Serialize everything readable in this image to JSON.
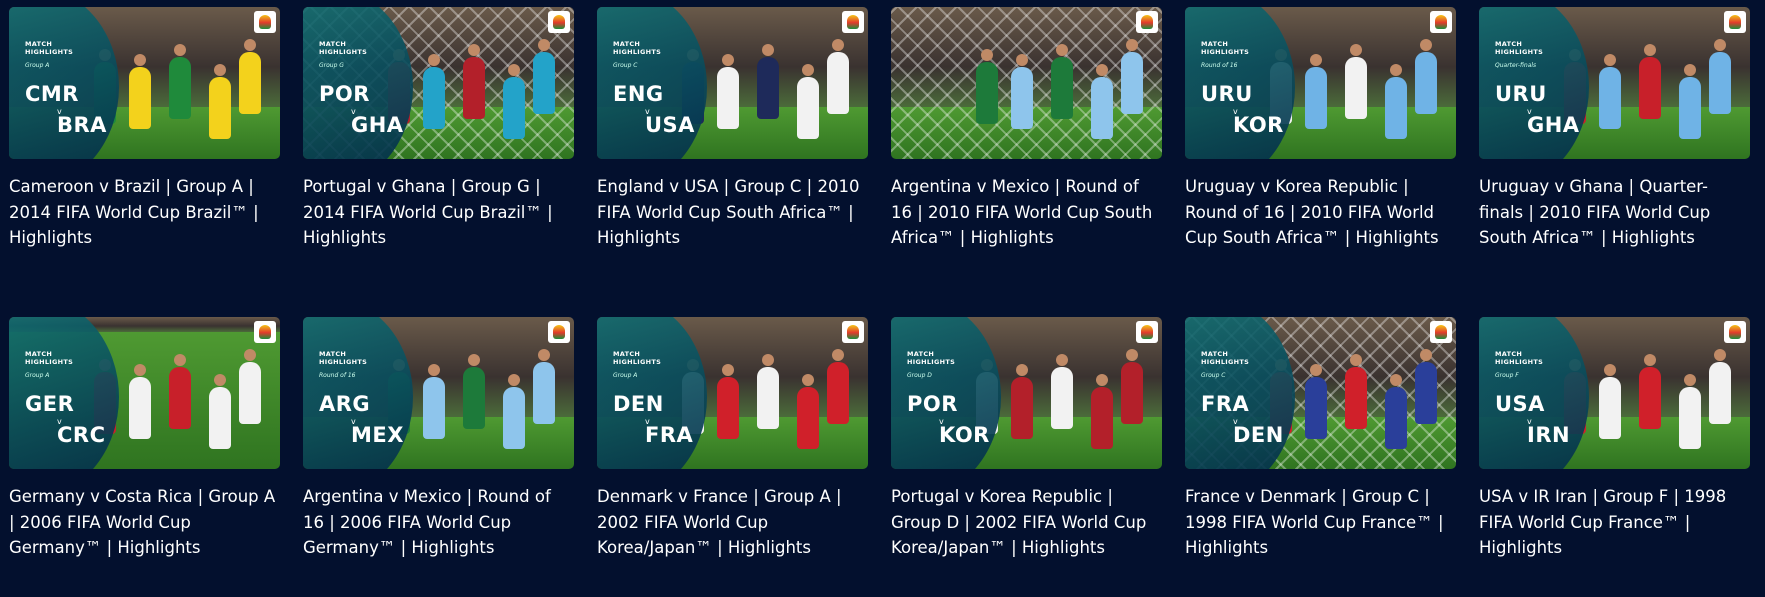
{
  "cards": [
    {
      "home": "CMR",
      "away": "BRA",
      "stage": "Group A",
      "match_highlights": "MATCH HIGHLIGHTS",
      "overlay": true,
      "title": "Cameroon v Brazil | Group A | 2014 FIFA World Cup Brazil™ | Highlights",
      "kit_a": "#f3d21c",
      "kit_b": "#1f8a3b",
      "scene": "stands"
    },
    {
      "home": "POR",
      "away": "GHA",
      "stage": "Group G",
      "match_highlights": "MATCH HIGHLIGHTS",
      "overlay": true,
      "title": "Portugal v Ghana | Group G | 2014 FIFA World Cup Brazil™ | Highlights",
      "kit_a": "#23a3c9",
      "kit_b": "#b3202a",
      "scene": "net"
    },
    {
      "home": "ENG",
      "away": "USA",
      "stage": "Group C",
      "match_highlights": "MATCH HIGHLIGHTS",
      "overlay": true,
      "title": "England v USA | Group C | 2010 FIFA World Cup South Africa™ | Highlights",
      "kit_a": "#f2f2f2",
      "kit_b": "#1e2a5a",
      "scene": "stands"
    },
    {
      "home": "",
      "away": "",
      "stage": "",
      "match_highlights": "",
      "overlay": false,
      "title": "Argentina v Mexico | Round of 16 | 2010 FIFA World Cup South Africa™ | Highlights",
      "kit_a": "#8ec5ec",
      "kit_b": "#1d7a3a",
      "scene": "net"
    },
    {
      "home": "URU",
      "away": "KOR",
      "stage": "Round of 16",
      "match_highlights": "MATCH HIGHLIGHTS",
      "overlay": true,
      "title": "Uruguay v Korea Republic | Round of 16 | 2010 FIFA World Cup South Africa™ | Highlights",
      "kit_a": "#6fb3e6",
      "kit_b": "#f2f2f2",
      "scene": "stands"
    },
    {
      "home": "URU",
      "away": "GHA",
      "stage": "Quarter-finals",
      "match_highlights": "MATCH HIGHLIGHTS",
      "overlay": true,
      "title": "Uruguay v Ghana | Quarter-finals | 2010 FIFA World Cup South Africa™ | Highlights",
      "kit_a": "#6fb3e6",
      "kit_b": "#c8202a",
      "scene": "stands"
    },
    {
      "home": "GER",
      "away": "CRC",
      "stage": "Group A",
      "match_highlights": "MATCH HIGHLIGHTS",
      "overlay": true,
      "title": "Germany v Costa Rica | Group A | 2006 FIFA World Cup Germany™ | Highlights",
      "kit_a": "#f2f2f2",
      "kit_b": "#c8202a",
      "scene": "pitch"
    },
    {
      "home": "ARG",
      "away": "MEX",
      "stage": "Round of 16",
      "match_highlights": "MATCH HIGHLIGHTS",
      "overlay": true,
      "title": "Argentina v Mexico | Round of 16 | 2006 FIFA World Cup Germany™ | Highlights",
      "kit_a": "#8ec5ec",
      "kit_b": "#1d7a3a",
      "scene": "stands"
    },
    {
      "home": "DEN",
      "away": "FRA",
      "stage": "Group A",
      "match_highlights": "MATCH HIGHLIGHTS",
      "overlay": true,
      "title": "Denmark v France | Group A | 2002 FIFA World Cup Korea/Japan™ | Highlights",
      "kit_a": "#d0202a",
      "kit_b": "#f2f2f2",
      "scene": "stands"
    },
    {
      "home": "POR",
      "away": "KOR",
      "stage": "Group D",
      "match_highlights": "MATCH HIGHLIGHTS",
      "overlay": true,
      "title": "Portugal v Korea Republic | Group D | 2002 FIFA World Cup Korea/Japan™ | Highlights",
      "kit_a": "#b3202a",
      "kit_b": "#f2f2f2",
      "scene": "stands"
    },
    {
      "home": "FRA",
      "away": "DEN",
      "stage": "Group C",
      "match_highlights": "MATCH HIGHLIGHTS",
      "overlay": true,
      "title": "France v Denmark | Group C | 1998 FIFA World Cup France™ | Highlights",
      "kit_a": "#2a3f9a",
      "kit_b": "#d0202a",
      "scene": "net"
    },
    {
      "home": "USA",
      "away": "IRN",
      "stage": "Group F",
      "match_highlights": "MATCH HIGHLIGHTS",
      "overlay": true,
      "title": "USA v IR Iran | Group F | 1998 FIFA World Cup France™ | Highlights",
      "kit_a": "#f2f2f2",
      "kit_b": "#d0202a",
      "scene": "stands"
    }
  ]
}
